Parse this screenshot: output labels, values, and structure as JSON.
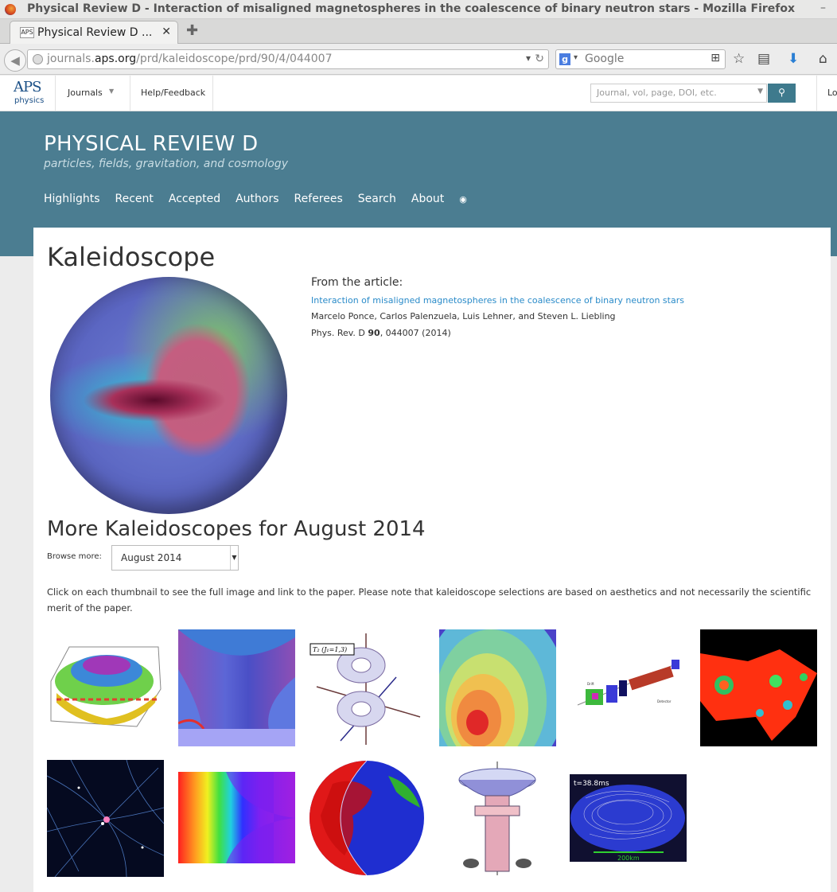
{
  "browser": {
    "window_title": "Physical Review D - Interaction of misaligned magnetospheres in the coalescence of binary neutron stars - Mozilla Firefox",
    "tab_label": "Physical Review D ...",
    "favicon_text": "APS",
    "url_prefix": "journals.",
    "url_domain": "aps.org",
    "url_path": "/prd/kaleidoscope/prd/90/4/044007",
    "search_placeholder": "Google",
    "search_engine_letter": "g"
  },
  "aps_bar": {
    "logo_text": "APS",
    "logo_sub": "physics",
    "journals": "Journals",
    "help": "Help/Feedback",
    "search_placeholder": "Journal, vol, page, DOI, etc.",
    "login": "Lo"
  },
  "journal": {
    "title": "PHYSICAL REVIEW D",
    "subtitle": "particles, fields, gravitation, and cosmology",
    "nav": [
      "Highlights",
      "Recent",
      "Accepted",
      "Authors",
      "Referees",
      "Search",
      "About"
    ]
  },
  "page": {
    "title": "Kaleidoscope",
    "from_label": "From the article:",
    "article_title": "Interaction of misaligned magnetospheres in the coalescence of binary neutron stars",
    "authors": "Marcelo Ponce, Carlos Palenzuela, Luis Lehner, and Steven L. Liebling",
    "citation_journal": "Phys. Rev. D ",
    "citation_volume": "90",
    "citation_rest": ", 044007 (2014)",
    "more_title": "More Kaleidoscopes for August 2014",
    "browse_label": "Browse more:",
    "browse_value": "August 2014",
    "note": "Click on each thumbnail to see the full image and link to the paper. Please note that kaleidoscope selections are based on aesthetics and not necessarily the scientific merit of the paper."
  },
  "thumbnails": {
    "t3_label": "T₂ (J₁=1,3)",
    "t11_label": "t=38.8ms",
    "t11_scale": "200km"
  },
  "colors": {
    "hero": "#4b7d91",
    "link": "#2a8bc9",
    "search_button": "#3e7a8d"
  }
}
